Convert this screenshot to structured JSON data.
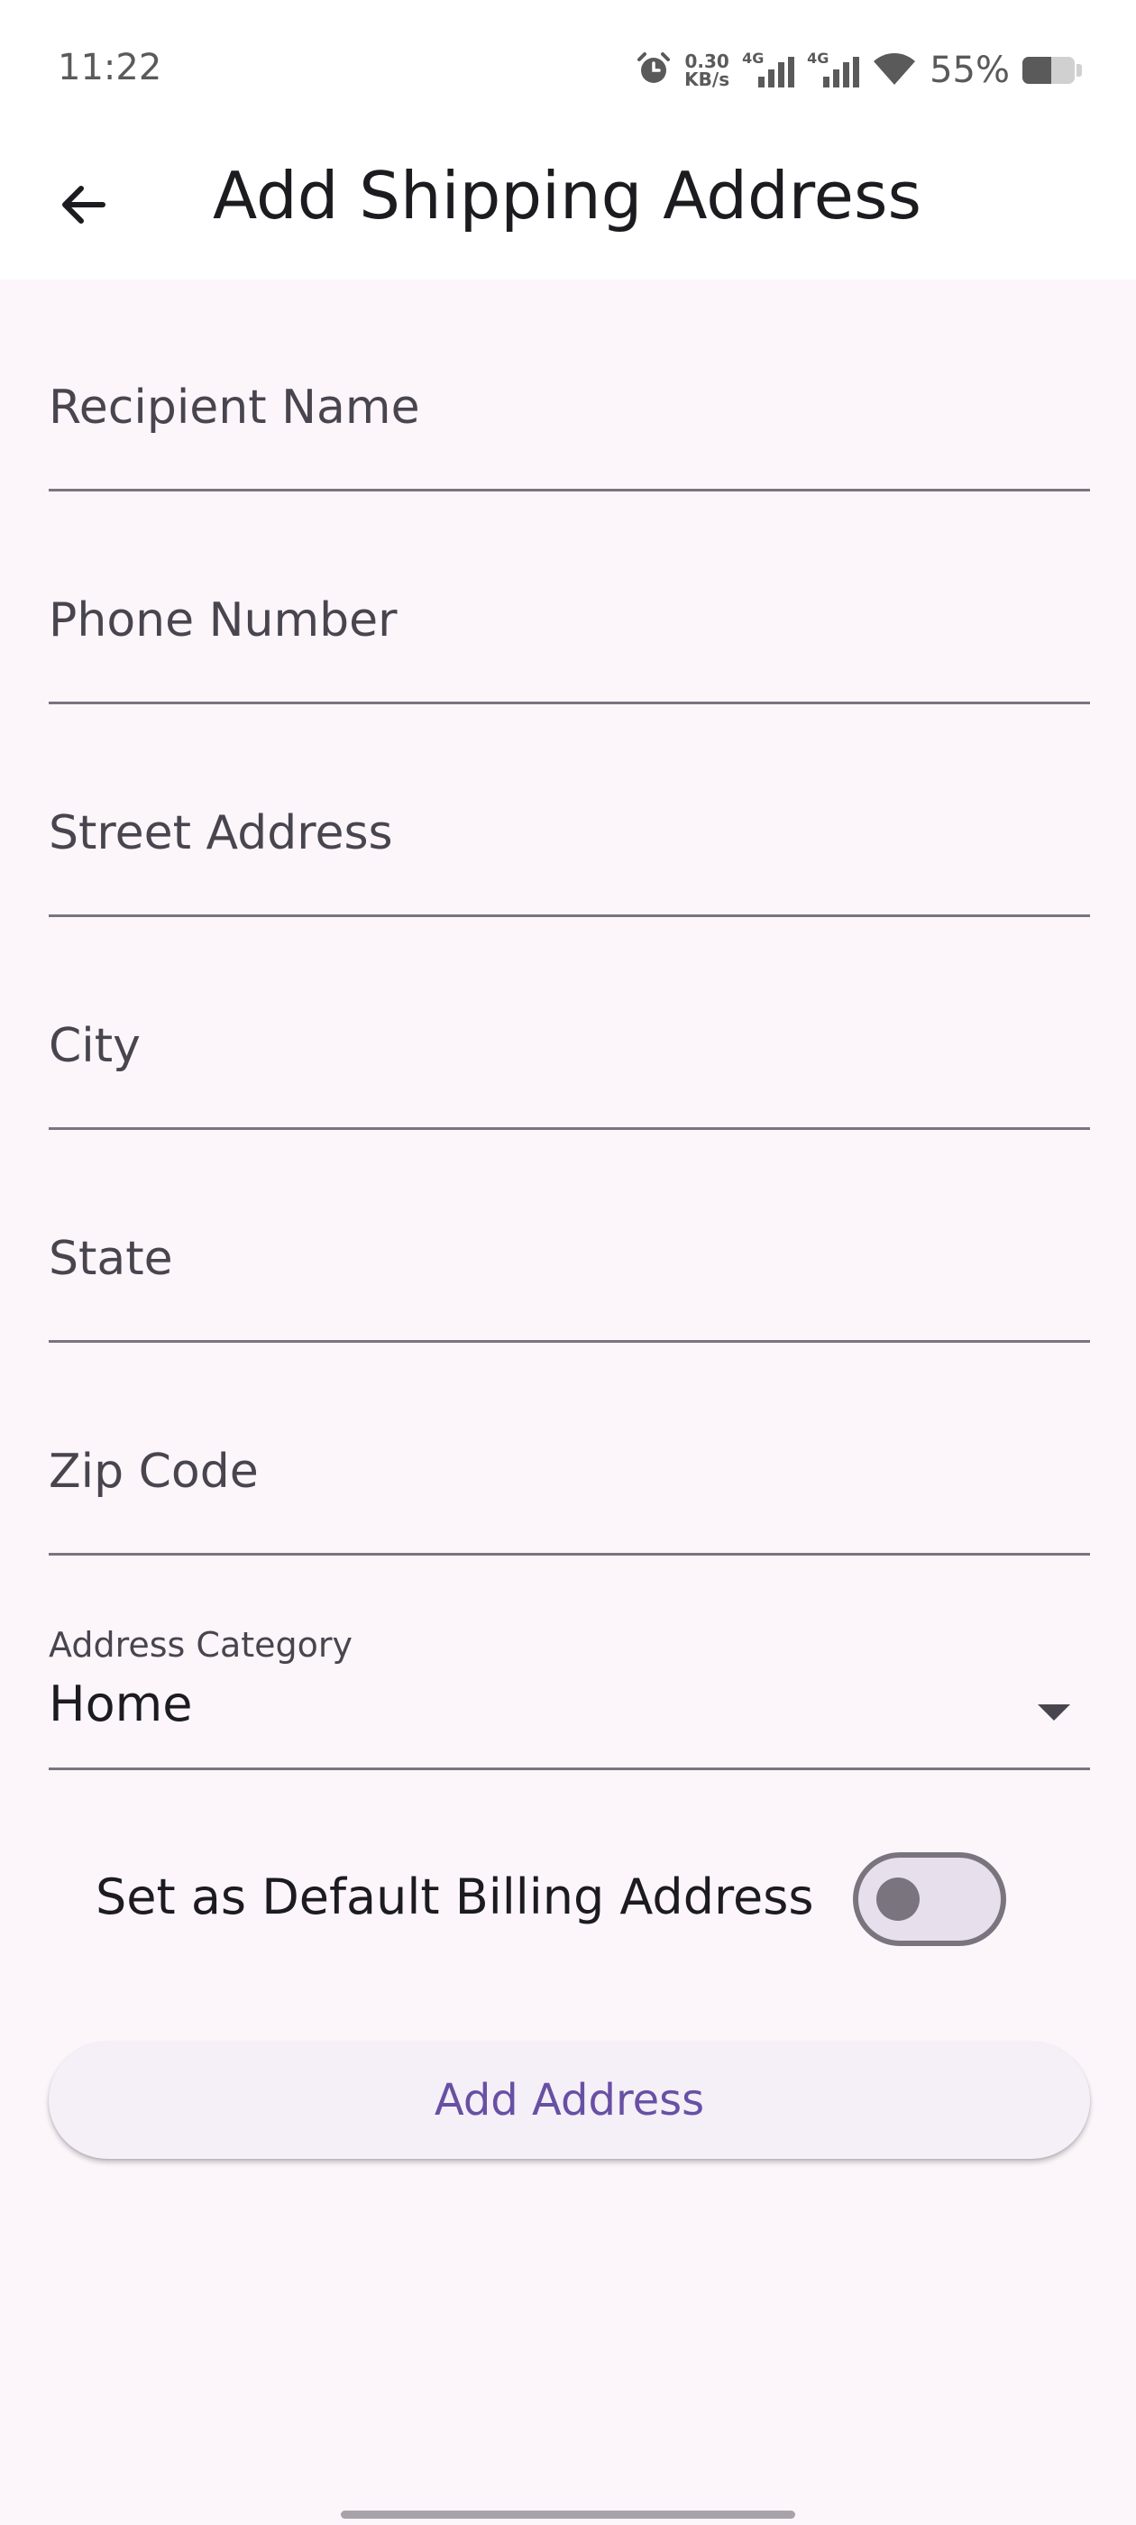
{
  "status_bar": {
    "time": "11:22",
    "net_speed_value": "0.30",
    "net_speed_unit": "KB/s",
    "signal1_tag": "4G",
    "signal2_tag": "4G",
    "battery_percent": "55%",
    "icons": [
      "alarm-icon",
      "signal-icon",
      "signal-icon",
      "wifi-icon",
      "battery-icon"
    ]
  },
  "app_bar": {
    "back_icon": "arrow-left-icon",
    "title": "Add Shipping Address"
  },
  "form": {
    "fields": [
      {
        "placeholder": "Recipient Name",
        "value": ""
      },
      {
        "placeholder": "Phone Number",
        "value": ""
      },
      {
        "placeholder": "Street Address",
        "value": ""
      },
      {
        "placeholder": "City",
        "value": ""
      },
      {
        "placeholder": "State",
        "value": ""
      },
      {
        "placeholder": "Zip Code",
        "value": ""
      }
    ],
    "category": {
      "label": "Address Category",
      "value": "Home",
      "icon": "dropdown-arrow-icon"
    },
    "default_billing": {
      "label": "Set as Default Billing Address",
      "checked": false
    },
    "submit_label": "Add Address"
  },
  "colors": {
    "background": "#fcf6fb",
    "primary": "#6750a4",
    "outline": "#79747e"
  }
}
